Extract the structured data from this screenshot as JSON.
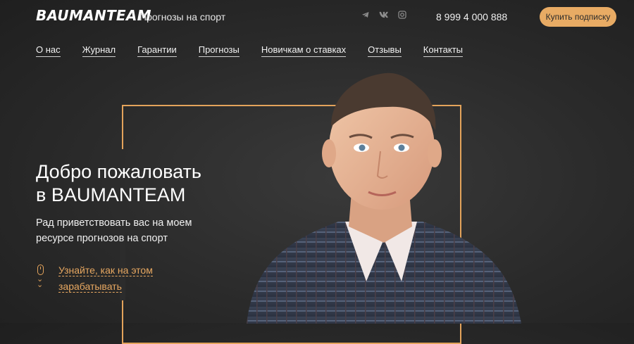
{
  "header": {
    "logo": "BAUMANTEAM",
    "tagline": "Прогнозы на спорт",
    "phone": "8 999 4 000 888",
    "cta_label": "Купить подписку",
    "socials": [
      "telegram-icon",
      "vk-icon",
      "instagram-icon"
    ]
  },
  "nav": {
    "items": [
      {
        "label": "О нас"
      },
      {
        "label": "Журнал"
      },
      {
        "label": "Гарантии"
      },
      {
        "label": "Прогнозы"
      },
      {
        "label": "Новичкам о ставках"
      },
      {
        "label": "Отзывы"
      },
      {
        "label": "Контакты"
      }
    ]
  },
  "hero": {
    "title_line1": "Добро пожаловать",
    "title_line2": "в BAUMANTEAM",
    "subtitle_line1": "Рад приветствовать вас на моем",
    "subtitle_line2": "ресурсе прогнозов на спорт",
    "link_line1": "Узнайте, как на этом",
    "link_line2": "зарабатывать"
  },
  "colors": {
    "accent": "#e8ab64",
    "background": "#2a2a2a"
  }
}
